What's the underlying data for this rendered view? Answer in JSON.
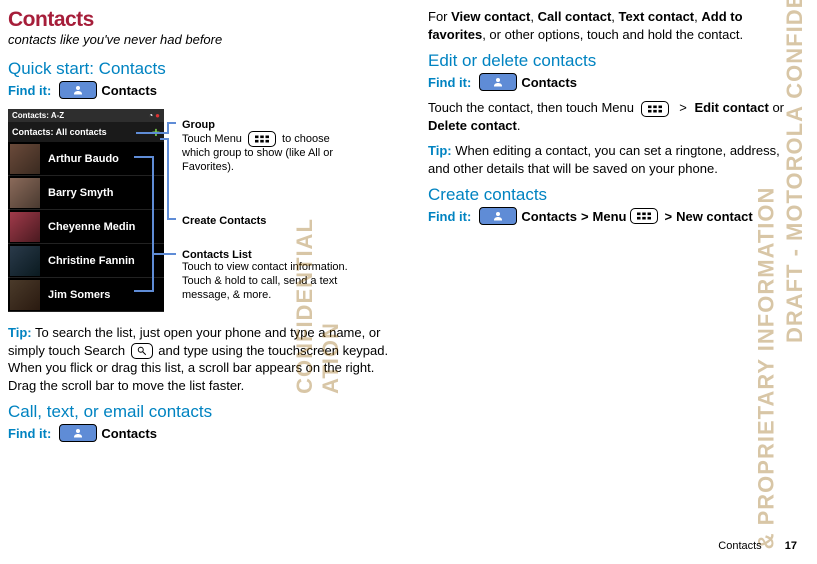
{
  "left": {
    "title": "Contacts",
    "subtitle": "contacts like you've never had before",
    "quickstart_heading": "Quick start: Contacts",
    "findit_label": "Find it:",
    "findit_after": "Contacts",
    "tip_label": "Tip:",
    "tip_text": " To search the list, just open your phone and type a name, or simply touch Search ",
    "tip_text2": " and type using the touchscreen keypad. When you flick or drag this list, a scroll bar appears on the right. Drag the scroll bar to move the list faster.",
    "call_heading": "Call, text, or email contacts"
  },
  "phone": {
    "status_left": "Contacts: A-Z",
    "group_header": "Contacts: All contacts",
    "rows": [
      "Arthur Baudo",
      "Barry Smyth",
      "Cheyenne Medin",
      "Christine Fannin",
      "Jim Somers"
    ]
  },
  "ann": {
    "group_title": "Group",
    "group_body1": "Touch Menu ",
    "group_body2": " to choose which group to show (like All or Favorites).",
    "create_title": "Create Contacts",
    "list_title": "Contacts  List",
    "list_body": "Touch to view contact information. Touch & hold to call, send a text message, & more."
  },
  "right": {
    "top_para1": "For ",
    "top_bold1": "View contact",
    "top_sep": ", ",
    "top_bold2": "Call contact",
    "top_bold3": "Text contact",
    "top_bold4": "Add to favorites",
    "top_para2": ", or other options, touch and hold the contact.",
    "edit_heading": "Edit or delete contacts",
    "edit_para1": "Touch the contact, then touch Menu ",
    "edit_para_bold1": "Edit contact",
    "edit_para_mid": " or ",
    "edit_para_bold2": "Delete contact",
    "edit_tip": " When editing a contact, you can set a ringtone, address, and other details that will be saved on your phone.",
    "create_heading": "Create contacts",
    "create_contacts": "Contacts",
    "create_menu": " Menu ",
    "create_new": "New contact"
  },
  "footer": {
    "label": "Contacts",
    "page": "17"
  },
  "watermarks": {
    "w1a": "DRAFT - MOTOROLA CONFIDENTIAL",
    "w1b": "& PROPRIETARY INFORMATION",
    "w2": "CONFIDENTIAL",
    "w3": "ATION"
  }
}
